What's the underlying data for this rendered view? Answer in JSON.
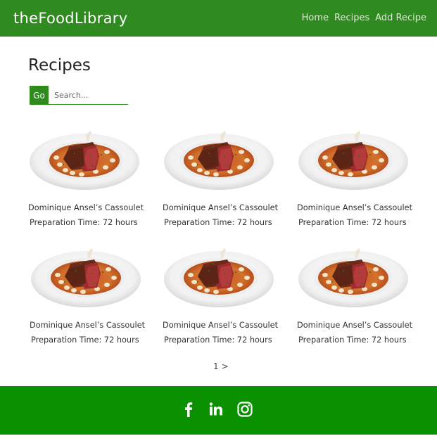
{
  "header": {
    "brand": "theFoodLibrary",
    "nav": [
      {
        "label": "Home"
      },
      {
        "label": "Recipes"
      },
      {
        "label": "Add Recipe"
      }
    ]
  },
  "main": {
    "title": "Recipes",
    "search": {
      "go_label": "Go",
      "placeholder": "Search..."
    },
    "recipes": [
      {
        "title": "Dominique Ansel’s Cassoulet",
        "prep": "Preparation Time: 72 hours"
      },
      {
        "title": "Dominique Ansel’s Cassoulet",
        "prep": "Preparation Time: 72 hours"
      },
      {
        "title": "Dominique Ansel’s Cassoulet",
        "prep": "Preparation Time: 72 hours"
      },
      {
        "title": "Dominique Ansel’s Cassoulet",
        "prep": "Preparation Time: 72 hours"
      },
      {
        "title": "Dominique Ansel’s Cassoulet",
        "prep": "Preparation Time: 72 hours"
      },
      {
        "title": "Dominique Ansel’s Cassoulet",
        "prep": "Preparation Time: 72 hours"
      }
    ],
    "pagination": {
      "current": "1",
      "next": ">"
    }
  },
  "footer": {
    "social_icons": [
      "facebook-icon",
      "linkedin-icon",
      "instagram-icon"
    ]
  },
  "colors": {
    "header_green": "#2f8a1f",
    "footer_green": "#0a9100"
  }
}
